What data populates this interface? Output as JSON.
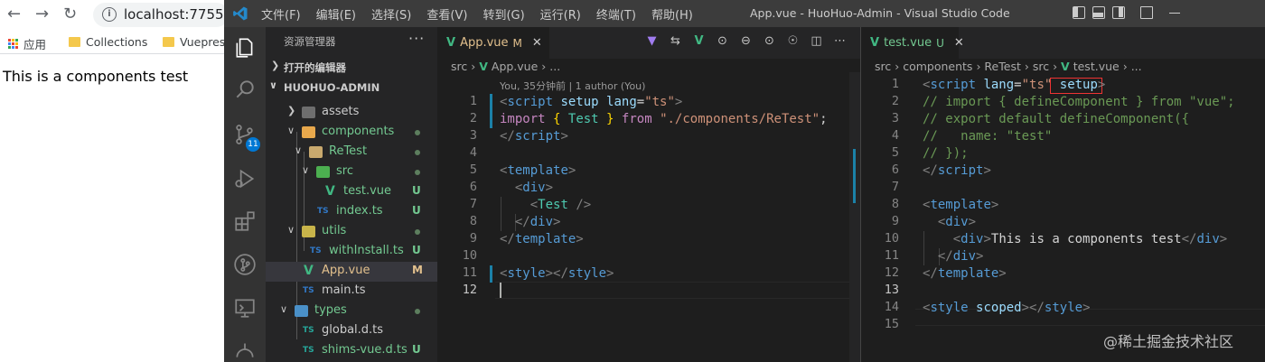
{
  "browser": {
    "url": "localhost:7755",
    "bookmarks": [
      {
        "label": "应用"
      },
      {
        "label": "Collections"
      },
      {
        "label": "Vuepres"
      }
    ],
    "page_text": "This is a components test"
  },
  "vscode": {
    "menu": [
      "文件(F)",
      "编辑(E)",
      "选择(S)",
      "查看(V)",
      "转到(G)",
      "运行(R)",
      "终端(T)",
      "帮助(H)"
    ],
    "window_title": "App.vue - HuoHuo-Admin - Visual Studio Code",
    "activity": {
      "scm_badge": "11"
    },
    "explorer": {
      "header": "资源管理器",
      "more": "···",
      "open_editors": "打开的编辑器",
      "project": "HUOHUO-ADMIN",
      "tree": [
        {
          "name": "assets",
          "status": ""
        },
        {
          "name": "components",
          "status": ""
        },
        {
          "name": "ReTest",
          "status": ""
        },
        {
          "name": "src",
          "status": ""
        },
        {
          "name": "test.vue",
          "status": "U",
          "icon": "V"
        },
        {
          "name": "index.ts",
          "status": "U",
          "icon": "TS"
        },
        {
          "name": "utils",
          "status": ""
        },
        {
          "name": "withInstall.ts",
          "status": "U",
          "icon": "TS"
        },
        {
          "name": "App.vue",
          "status": "M",
          "icon": "V"
        },
        {
          "name": "main.ts",
          "status": "",
          "icon": "TS"
        },
        {
          "name": "types",
          "status": ""
        },
        {
          "name": "global.d.ts",
          "status": "",
          "icon": "TS"
        },
        {
          "name": "shims-vue.d.ts",
          "status": "U",
          "icon": "TS"
        }
      ]
    },
    "left_editor": {
      "tab_label": "App.vue",
      "tab_status": "M",
      "breadcrumb": [
        "src",
        "App.vue",
        "..."
      ],
      "codelens": "You, 35分钟前 | 1 author (You)",
      "line_numbers": [
        "1",
        "2",
        "3",
        "4",
        "5",
        "6",
        "7",
        "8",
        "9",
        "10",
        "11",
        "12"
      ]
    },
    "right_editor": {
      "tab_label": "test.vue",
      "tab_status": "U",
      "breadcrumb": [
        "src",
        "components",
        "ReTest",
        "src",
        "test.vue",
        "..."
      ],
      "line_numbers": [
        "1",
        "2",
        "3",
        "4",
        "5",
        "6",
        "7",
        "8",
        "9",
        "10",
        "11",
        "12",
        "13",
        "14",
        "15"
      ]
    },
    "watermark": "@稀土掘金技术社区"
  }
}
